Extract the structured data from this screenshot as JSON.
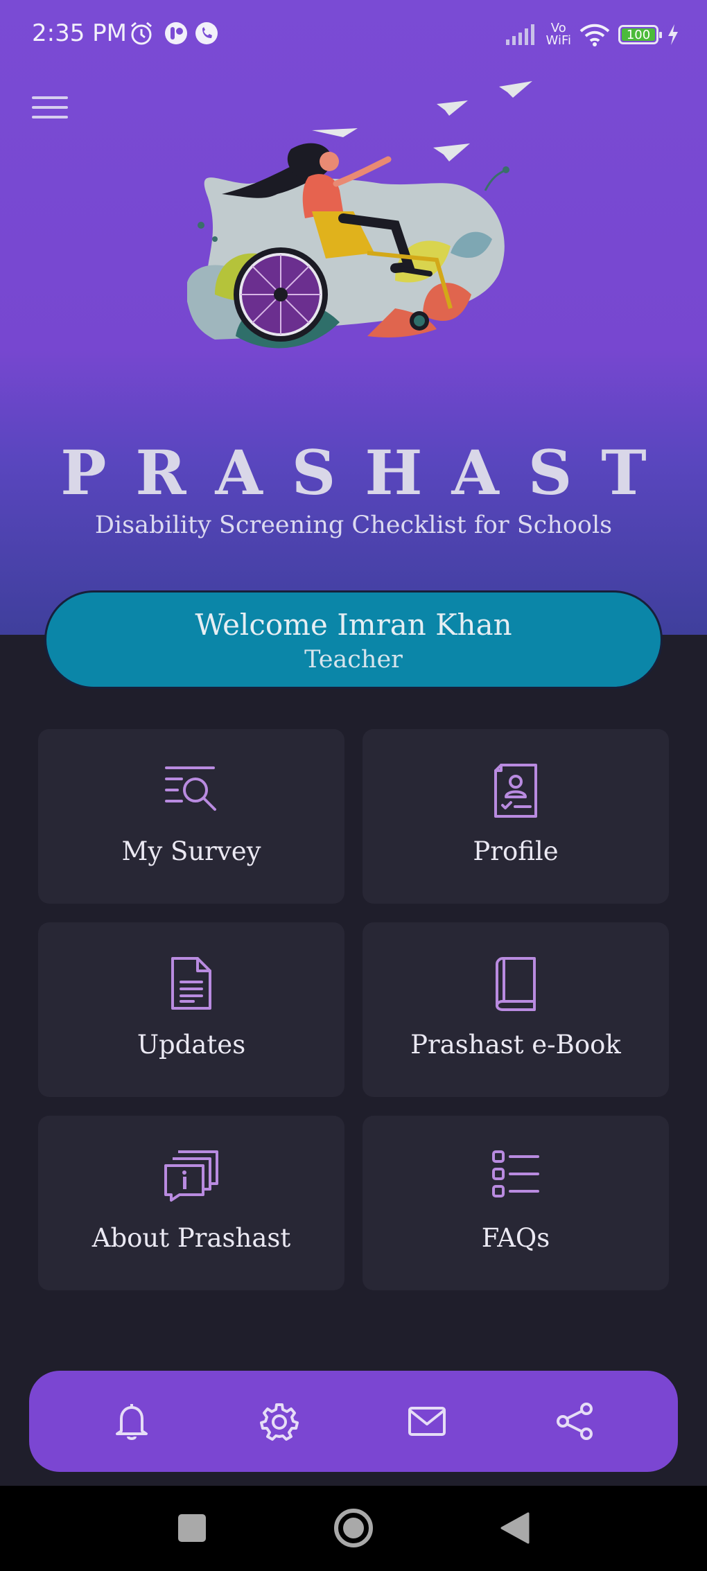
{
  "status_bar": {
    "time": "2:35 PM",
    "network_label_top": "Vo",
    "network_label_bottom": "WiFi",
    "battery": "100",
    "icons": [
      "alarm-icon",
      "app-notification-icon",
      "whatsapp-icon",
      "signal-icon",
      "wifi-icon",
      "battery-icon",
      "charging-icon"
    ]
  },
  "header": {
    "menu_icon": "hamburger-menu-icon",
    "illustration": "girl-in-wheelchair-with-paper-planes",
    "title": "PRASHAST",
    "subtitle": "Disability Screening Checklist for Schools"
  },
  "welcome": {
    "greeting": "Welcome Imran Khan",
    "role": "Teacher"
  },
  "tiles": [
    {
      "label": "My Survey",
      "icon": "survey-search-icon"
    },
    {
      "label": "Profile",
      "icon": "profile-document-icon"
    },
    {
      "label": "Updates",
      "icon": "document-icon"
    },
    {
      "label": "Prashast e-Book",
      "icon": "book-icon"
    },
    {
      "label": "About Prashast",
      "icon": "info-chat-icon"
    },
    {
      "label": "FAQs",
      "icon": "checklist-icon"
    }
  ],
  "bottom_nav": {
    "items": [
      "notification-bell-icon",
      "settings-gear-icon",
      "mail-icon",
      "share-icon"
    ]
  },
  "system_nav": {
    "items": [
      "recents-square-icon",
      "home-circle-icon",
      "back-triangle-icon"
    ]
  },
  "colors": {
    "hero_purple": "#7a4bd4",
    "welcome_teal": "#0b86a8",
    "background": "#1f1e2b",
    "tile": "#282735",
    "icon_lilac": "#b98be0",
    "bottom_nav": "#7b46d2"
  }
}
